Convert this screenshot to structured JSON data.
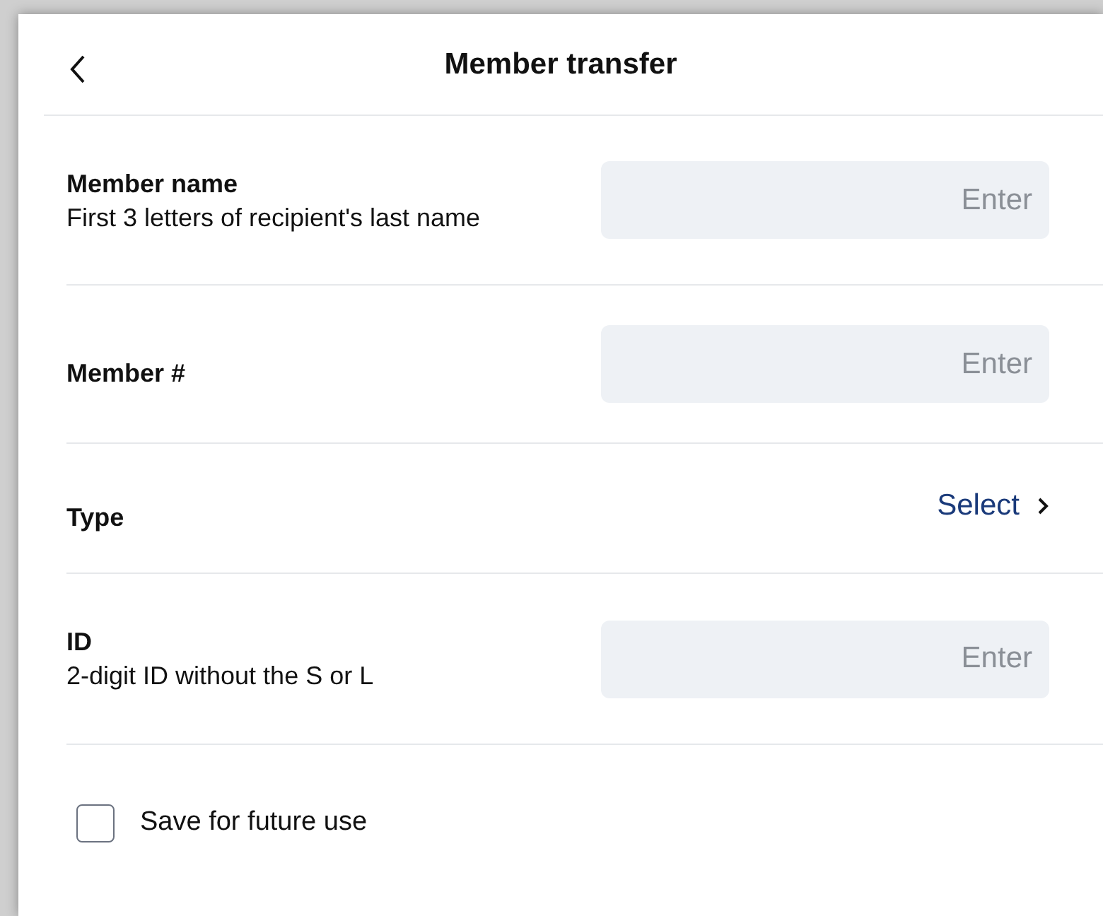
{
  "header": {
    "title": "Member transfer"
  },
  "rows": [
    {
      "kind": "field",
      "label": "Member name",
      "hint": "First 3 letters of recipient's last name",
      "placeholder": "Enter"
    },
    {
      "kind": "field",
      "label": "Member #",
      "placeholder": "Enter"
    },
    {
      "kind": "select",
      "label": "Type",
      "value": "Select"
    },
    {
      "kind": "field",
      "label": "ID",
      "hint": "2-digit ID without the S or L",
      "placeholder": "Enter"
    }
  ],
  "save": {
    "label": "Save for future use",
    "checked": false
  }
}
